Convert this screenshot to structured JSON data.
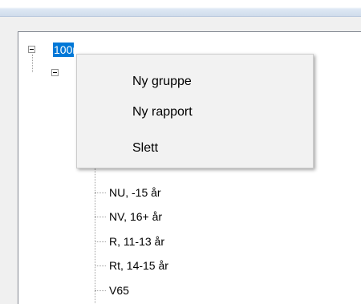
{
  "tree": {
    "root_label": "100m",
    "children": [
      "NU, -15 år",
      "NV, 16+ år",
      "R, 11-13 år",
      "Rt, 14-15 år",
      "V65"
    ]
  },
  "context_menu": {
    "items": [
      "Ny gruppe",
      "Ny rapport",
      "Slett"
    ]
  },
  "icons": {
    "expand_root": "collapse-minus-icon",
    "expand_child": "collapse-minus-icon"
  }
}
